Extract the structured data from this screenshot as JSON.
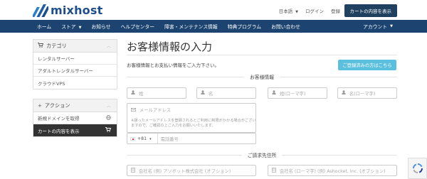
{
  "header": {
    "brand": "mixhost",
    "language": "日本語",
    "login": "ログイン",
    "register": "登録",
    "cart_button": "カートの内容を表示"
  },
  "nav": {
    "items": [
      {
        "label": "ホーム"
      },
      {
        "label": "ストア"
      },
      {
        "label": "お知らせ"
      },
      {
        "label": "ヘルプセンター"
      },
      {
        "label": "障害・メンテナンス情報"
      },
      {
        "label": "特典プログラム"
      },
      {
        "label": "お問い合わせ"
      }
    ],
    "account": "アカウント"
  },
  "sidebar": {
    "categories": {
      "title": "カテゴリ",
      "items": [
        {
          "label": "レンタルサーバー"
        },
        {
          "label": "アダルトレンタルサーバー"
        },
        {
          "label": "クラウドVPS"
        }
      ]
    },
    "actions": {
      "title": "アクション",
      "items": [
        {
          "label": "新規ドメインを取得"
        },
        {
          "label": "カートの内容を表示"
        }
      ]
    }
  },
  "main": {
    "title": "お客様情報の入力",
    "intro": "お客様情報とお支払い情報をご入力下さい。",
    "login_button": "ご登録済みの方はこちら",
    "customer_section": "お客様情報",
    "fields": {
      "last_name": "姓",
      "first_name": "名",
      "last_name_kana": "姓(ローマ字)",
      "first_name_kana": "名(ローマ字)",
      "email": "メールアドレス",
      "email_note": "※誤ったメールアドレスを登録されるとご利用に制限がかかる場合がございますので、ご確認の上ご入力をお願いいたします。",
      "dial_code": "+81",
      "phone": "電話番号"
    },
    "billing_section": "ご請求先住所",
    "billing_fields": {
      "company": "会社名 (例) アソボット株式会社 (オプション)",
      "company_roman": "会社名 (ローマ字) (例) Ashocket, Inc. (オプション)"
    }
  },
  "colors": {
    "navbar": "#1d4470",
    "brand": "#1e4e8c",
    "login_button": "#5bc0de",
    "active_sidebar": "#333333"
  }
}
